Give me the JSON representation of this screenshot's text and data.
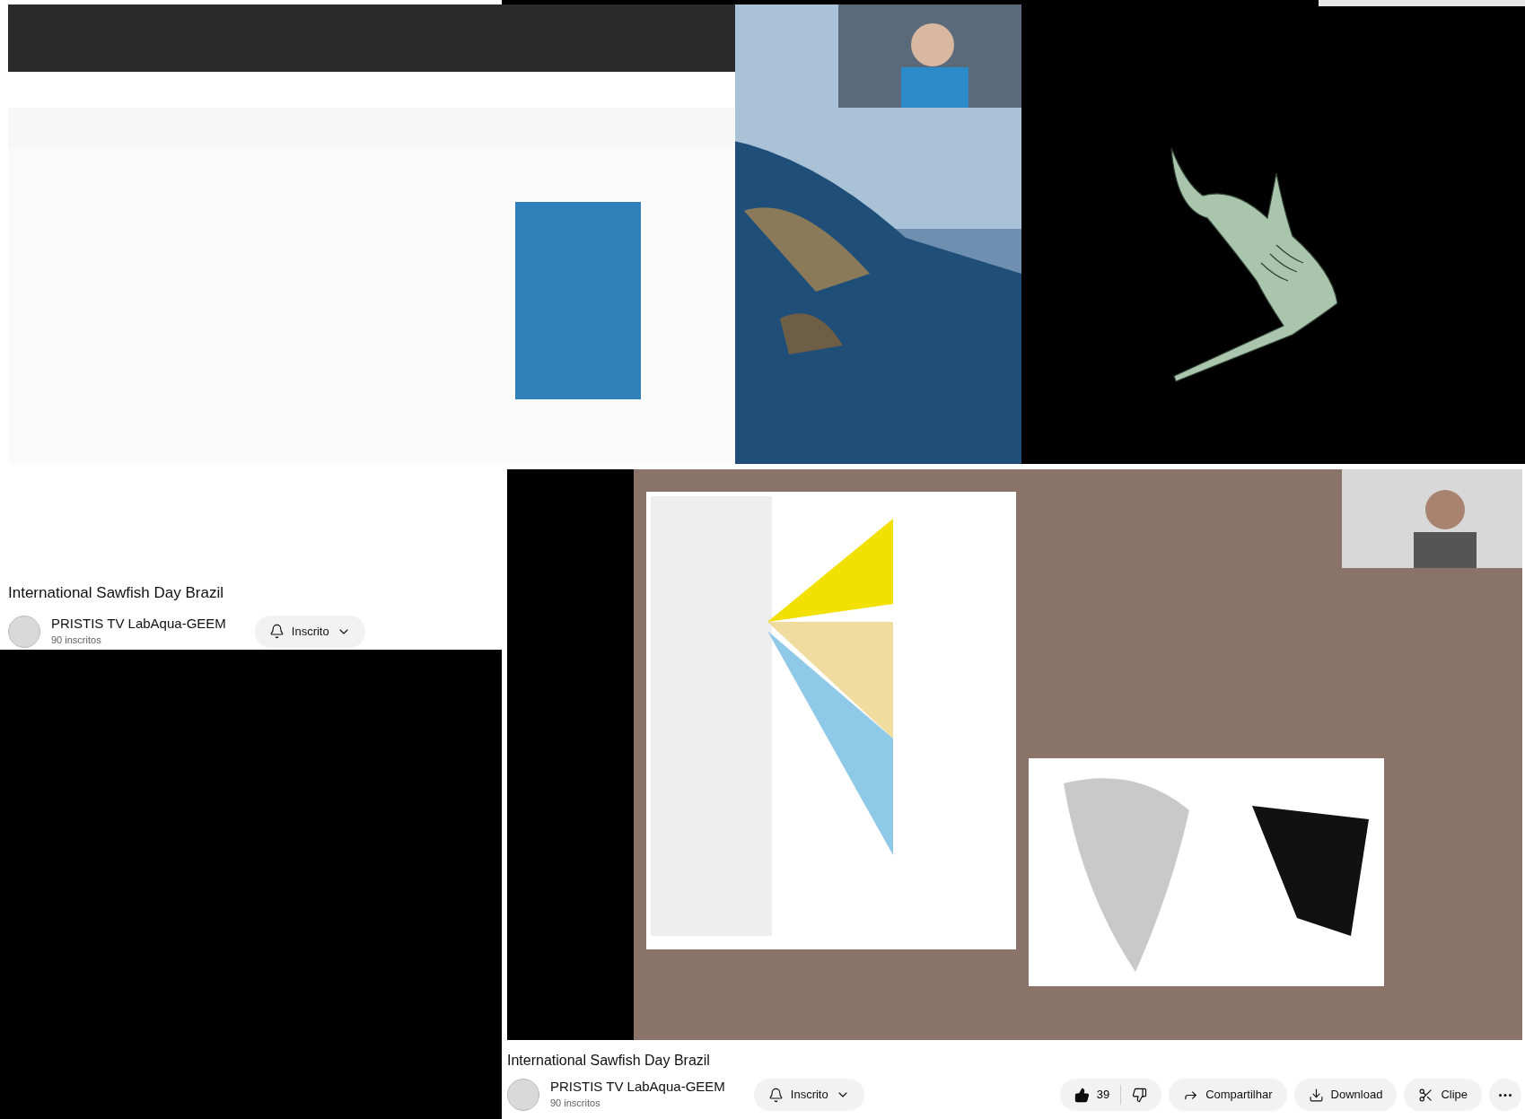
{
  "videos": [
    {
      "kind": "picture",
      "title": "International Sawfish Day Brazil",
      "channel": "PRISTIS TV LabAqua-GEEM",
      "subscribers": "90 inscritos",
      "subscribe_label": "Inscrito"
    },
    {
      "kind": "picture",
      "title": "International Sawfish Day Brazil",
      "channel": "PRISTIS TV LabAqua-GEEM",
      "subscribers": "90 inscritos",
      "subscribe_label": "Inscrito",
      "like": {
        "count": "39",
        "liked": true
      },
      "actions": [
        {
          "kind": "share",
          "label": "Compartilhar"
        },
        {
          "kind": "download",
          "label": "Download"
        },
        {
          "kind": "clip",
          "label": "Clipe"
        },
        {
          "kind": "more"
        }
      ]
    }
  ]
}
